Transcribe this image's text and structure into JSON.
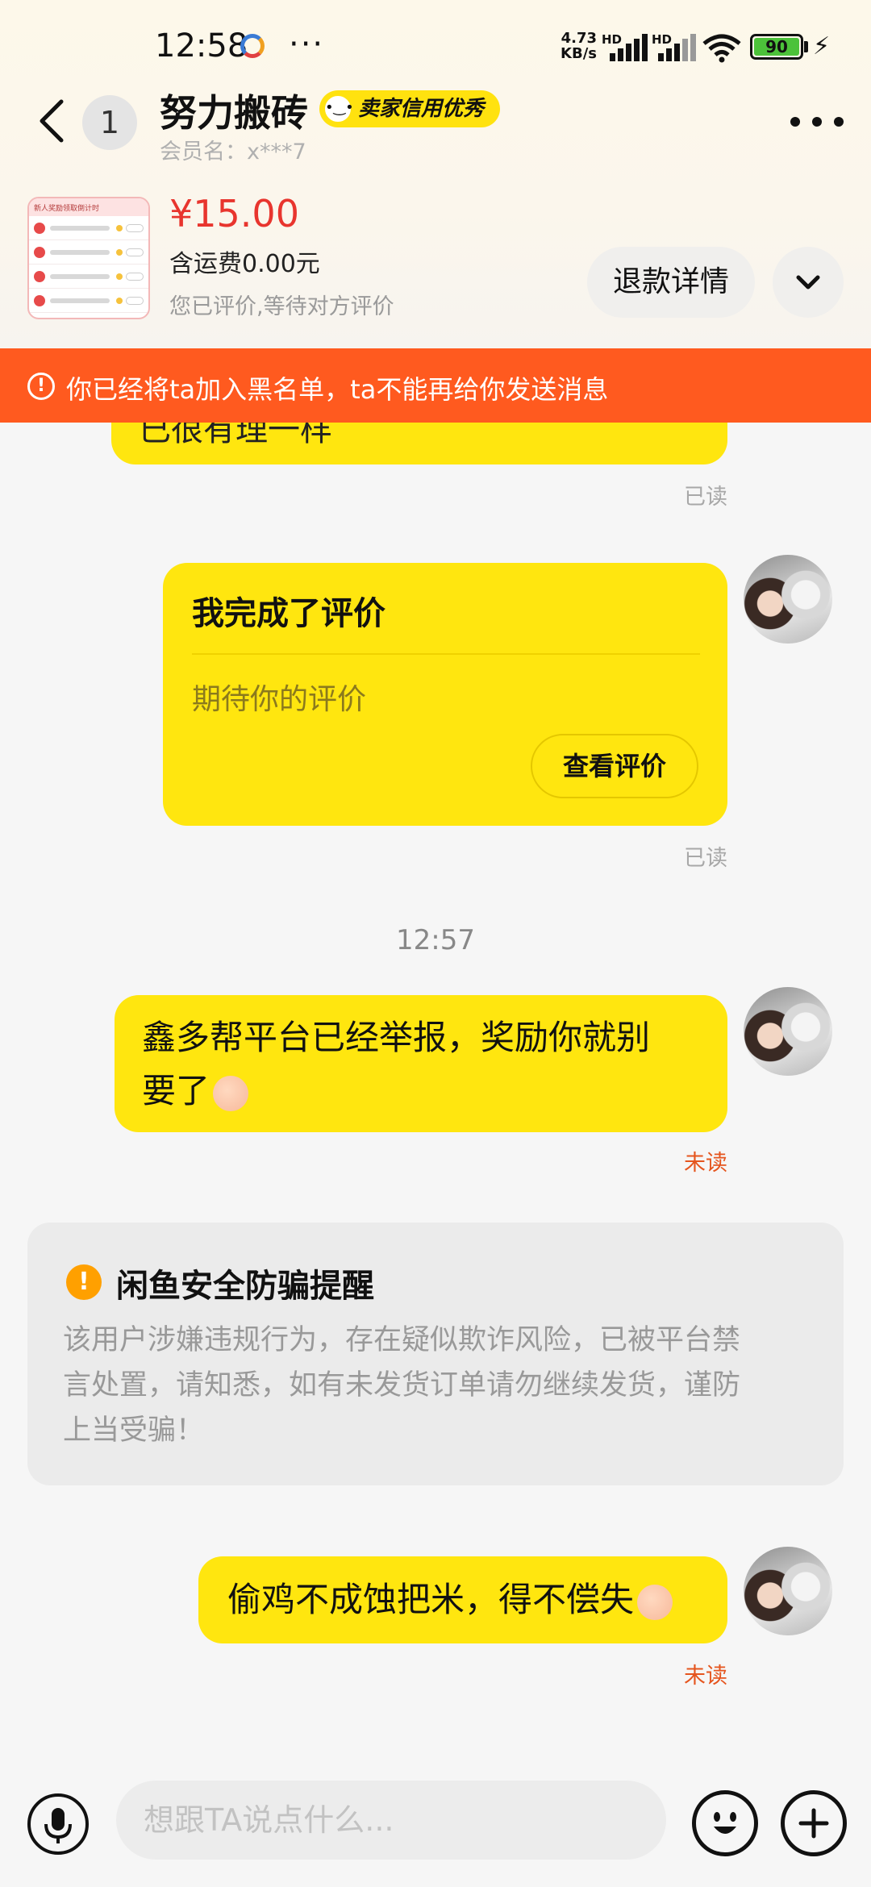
{
  "status_bar": {
    "time": "12:58",
    "dots": "···",
    "net_speed_value": "4.73",
    "net_speed_unit": "KB/s",
    "sim1_label": "HD",
    "sim2_label": "HD",
    "battery_level": "90",
    "app_icon": "baidu-app-icon",
    "icons": [
      "signal-icon",
      "wifi-icon",
      "battery-icon",
      "charging-icon"
    ]
  },
  "header": {
    "unread_count": "1",
    "contact_name": "努力搬砖",
    "credit_badge": "卖家信用优秀",
    "member_name": "会员名：x***7",
    "icons": [
      "back-icon",
      "more-icon"
    ]
  },
  "order": {
    "thumb_caption": "新人奖励领取倒计时",
    "price": "¥15.00",
    "shipping": "含运费0.00元",
    "status": "您已评价,等待对方评价",
    "refund_button": "退款详情",
    "icons": [
      "chevron-down-icon"
    ]
  },
  "blacklist_notice": "你已经将ta加入黑名单，ta不能再给你发送消息",
  "messages": {
    "partial_text": "已很有理一样",
    "partial_read": "已读",
    "eval_card": {
      "title": "我完成了评价",
      "subtitle": "期待你的评价",
      "button": "查看评价",
      "read": "已读"
    },
    "time_divider": "12:57",
    "report_msg": {
      "line1": "鑫多帮平台已经举报，奖励你就别",
      "line2": "要了",
      "read": "未读"
    },
    "safety_card": {
      "title": "闲鱼安全防骗提醒",
      "line1": "该用户涉嫌违规行为，存在疑似欺诈风险，已被平台禁",
      "line2": "言处置，请知悉，如有未发货订单请勿继续发货，谨防",
      "line3": "上当受骗！",
      "icon": "warning-icon"
    },
    "last_msg": {
      "text": "偷鸡不成蚀把米，得不偿失",
      "read": "未读"
    }
  },
  "input_bar": {
    "placeholder": "想跟TA说点什么...",
    "value": "",
    "icons": [
      "microphone-icon",
      "emoji-icon",
      "plus-icon"
    ]
  },
  "colors": {
    "bubble": "#ffe60f",
    "banner": "#ff5a1f",
    "price": "#e8352e",
    "unread": "#e5551e"
  }
}
